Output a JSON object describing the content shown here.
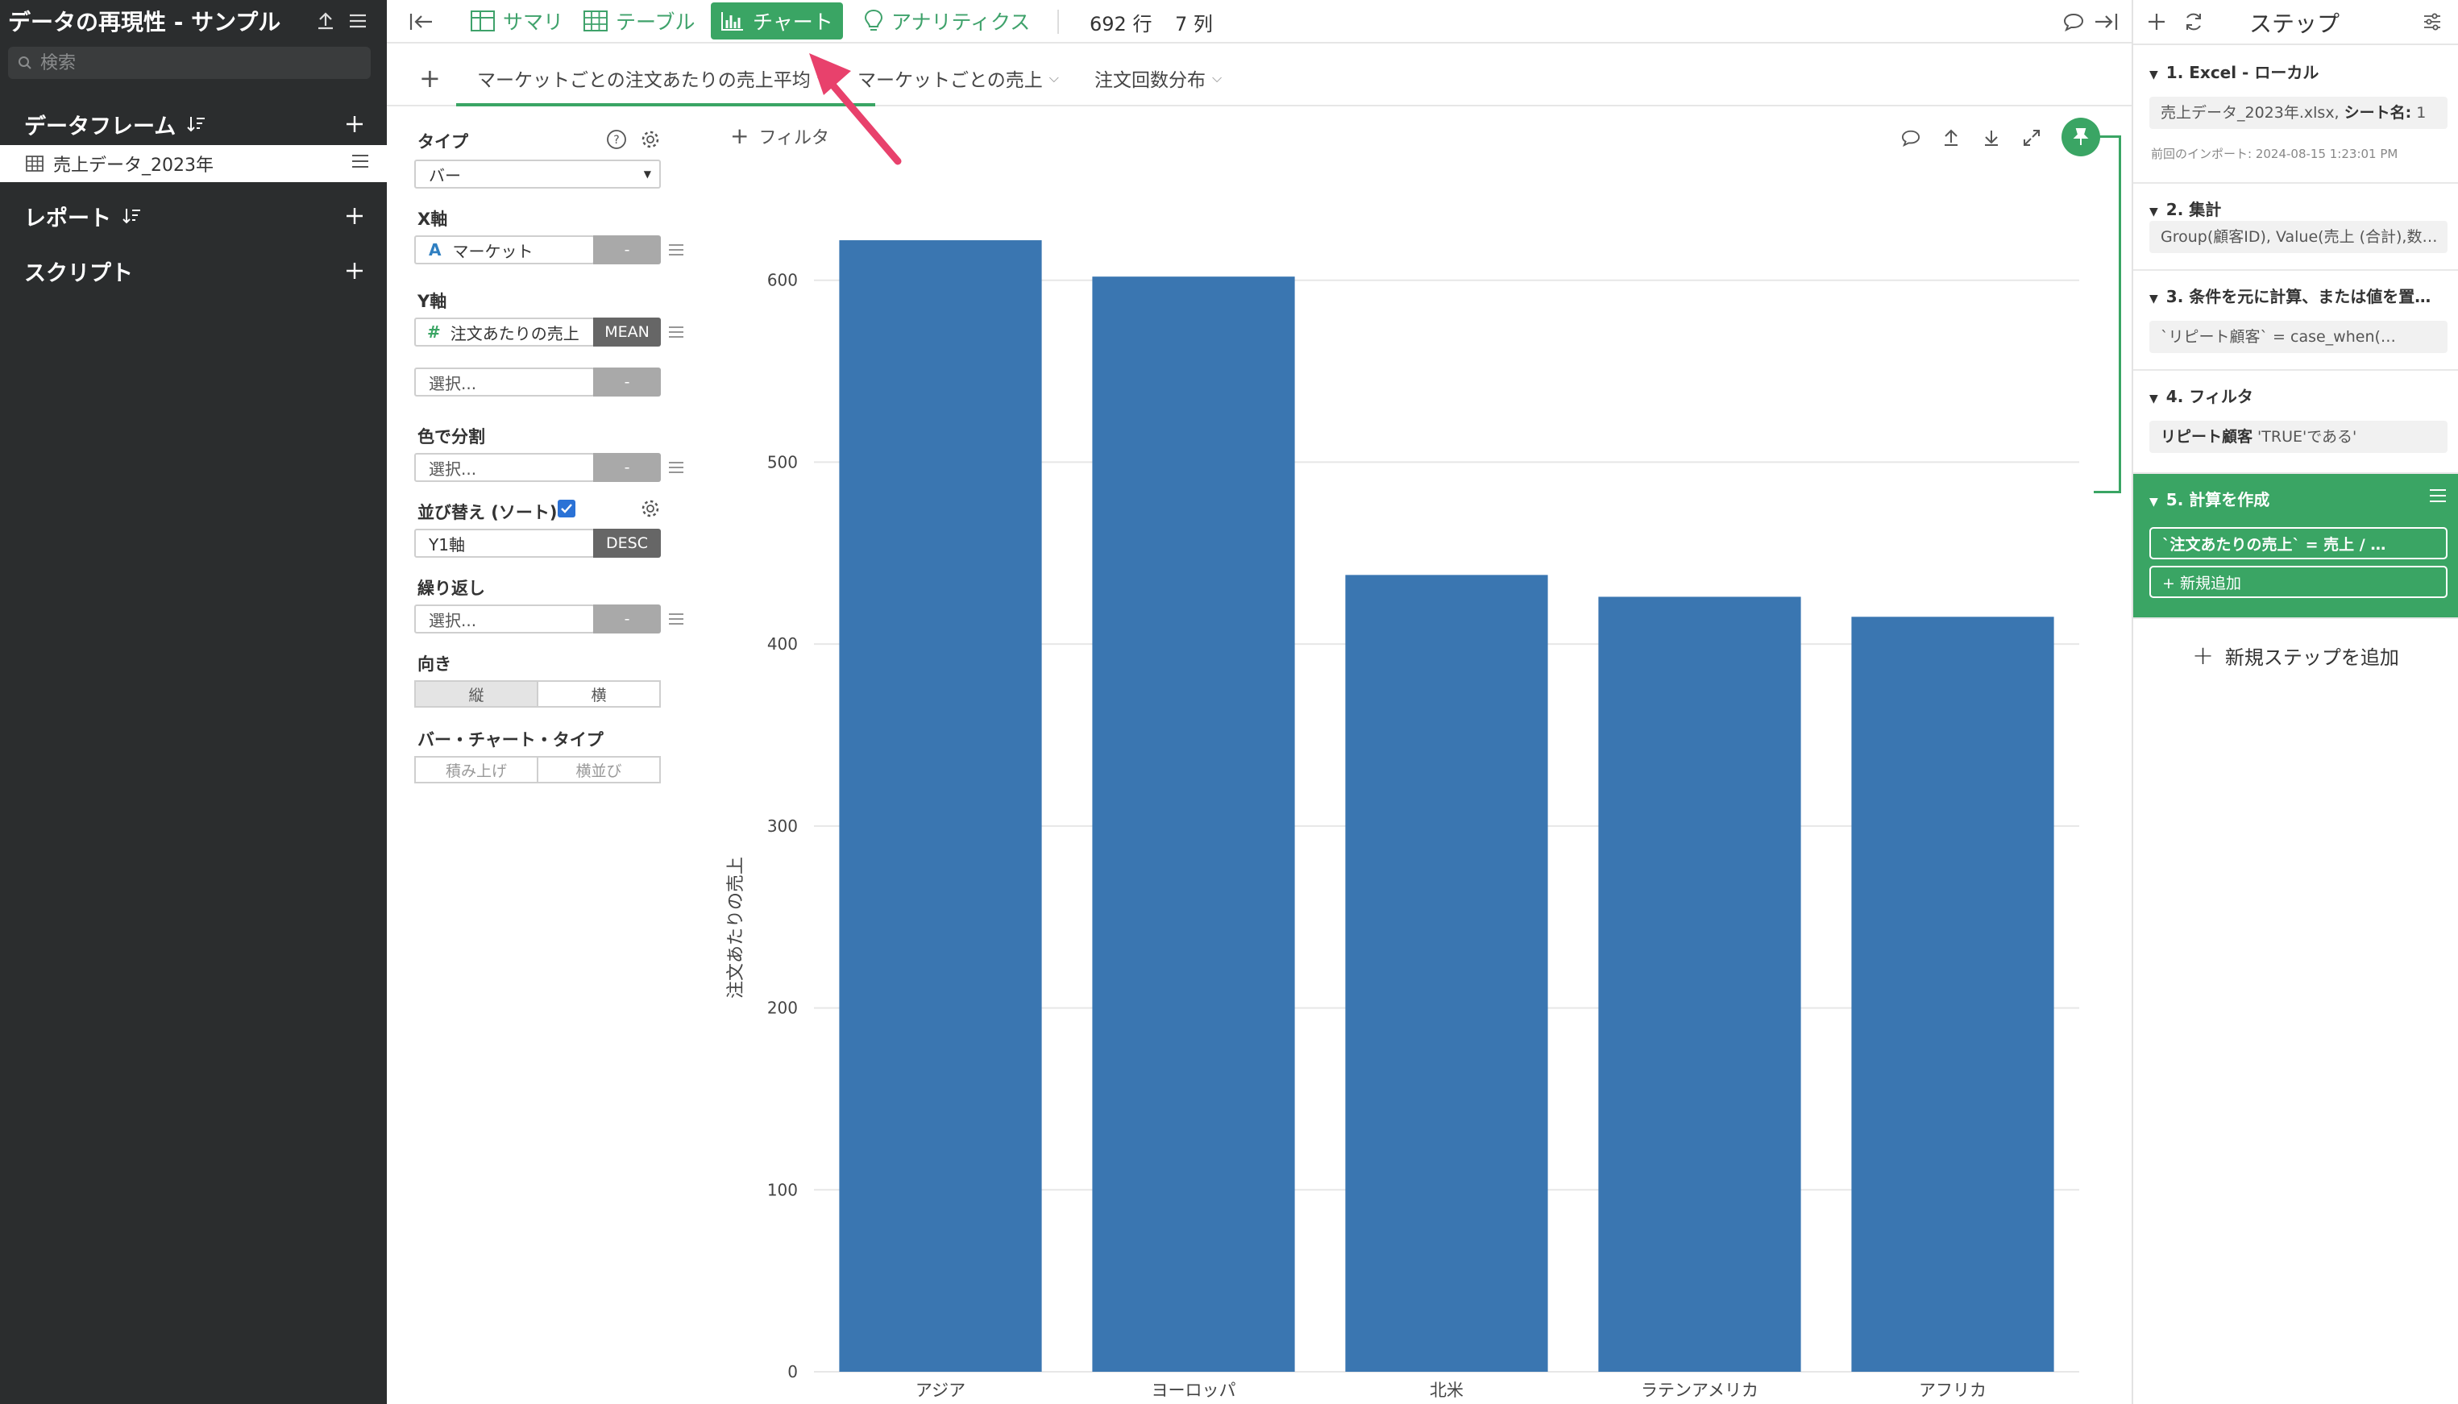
{
  "sidebar": {
    "title": "データの再現性 - サンプル",
    "search_placeholder": "検索",
    "dataframes_label": "データフレーム",
    "dataframe_item": "売上データ_2023年",
    "reports_label": "レポート",
    "scripts_label": "スクリプト"
  },
  "toolbar": {
    "summary": "サマリ",
    "table": "テーブル",
    "chart": "チャート",
    "analytics": "アナリティクス",
    "rows": "692 行",
    "cols": "7 列"
  },
  "tabs": {
    "items": [
      "マーケットごとの注文あたりの売上平均",
      "マーケットごとの売上",
      "注文回数分布"
    ]
  },
  "config": {
    "type_label": "タイプ",
    "type_value": "バー",
    "x_label": "X軸",
    "x_value": "マーケット",
    "x_tag": "-",
    "y_label": "Y軸",
    "y_value": "注文あたりの売上",
    "y_tag": "MEAN",
    "y2_placeholder": "選択...",
    "y2_tag": "-",
    "color_label": "色で分割",
    "color_placeholder": "選択...",
    "color_tag": "-",
    "sort_label": "並び替え (ソート)",
    "sort_value": "Y1軸",
    "sort_tag": "DESC",
    "repeat_label": "繰り返し",
    "repeat_placeholder": "選択...",
    "repeat_tag": "-",
    "orient_label": "向き",
    "orient_options": [
      "縦",
      "横"
    ],
    "bartype_label": "バー・チャート・タイプ",
    "bartype_options": [
      "積み上げ",
      "横並び"
    ],
    "filter_label": "フィルタ"
  },
  "steps": {
    "title": "ステップ",
    "items": [
      {
        "title": "1. Excel - ローカル",
        "detail_pre": "売上データ_2023年.xlsx, ",
        "detail_bold": "シート名:",
        "detail_post": " 1",
        "sub": "前回のインポート: 2024-08-15 1:23:01 PM"
      },
      {
        "title": "2. 集計",
        "detail": "Group(顧客ID), Value(売上 (合計),数…"
      },
      {
        "title": "3. 条件を元に計算、または値を置…",
        "detail": "`リピート顧客` = case_when(…"
      },
      {
        "title": "4. フィルタ",
        "detail_bold": "リピート顧客",
        "detail_post": " 'TRUE'である'"
      },
      {
        "title": "5. 計算を作成",
        "detail": "`注文あたりの売上` = 売上 / …",
        "add": "+ 新規追加"
      }
    ],
    "add_step": "新規ステップを追加"
  },
  "colors": {
    "accent": "#3aa564",
    "bar": "#3a76b1",
    "annotation": "#e8416c"
  },
  "chart_data": {
    "type": "bar",
    "categories": [
      "アジア",
      "ヨーロッパ",
      "北米",
      "ラテンアメリカ",
      "アフリカ"
    ],
    "values": [
      622,
      602,
      438,
      426,
      415
    ],
    "title": "",
    "xlabel": "",
    "ylabel": "注文あたりの売上",
    "ylim": [
      0,
      630
    ],
    "yticks": [
      0,
      100,
      200,
      300,
      400,
      500,
      600
    ],
    "grid": true
  }
}
